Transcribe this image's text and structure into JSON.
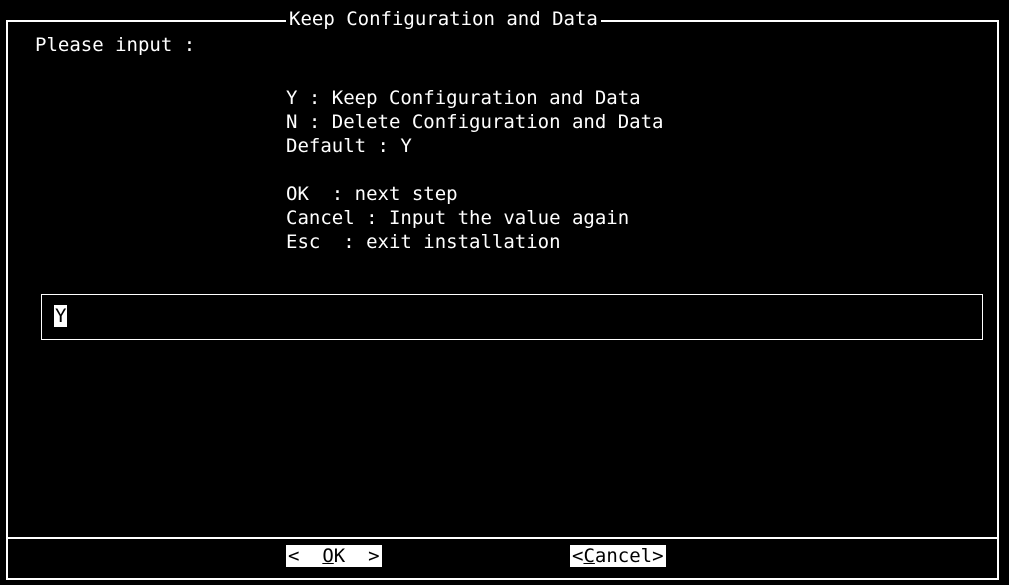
{
  "dialog": {
    "title": "Keep Configuration and Data",
    "prompt": "Please input :",
    "options": [
      "Y : Keep Configuration and Data",
      "N : Delete Configuration and Data",
      "Default : Y"
    ],
    "help": [
      "OK  : next step",
      "Cancel : Input the value again",
      "Esc  : exit installation"
    ]
  },
  "input": {
    "value": "Y"
  },
  "buttons": {
    "ok_left": "<  ",
    "ok_hotkey": "O",
    "ok_rest": "K  >",
    "cancel_left": "<",
    "cancel_hotkey": "C",
    "cancel_rest": "ancel>"
  },
  "colors": {
    "background": "#000000",
    "foreground": "#ffffff"
  }
}
